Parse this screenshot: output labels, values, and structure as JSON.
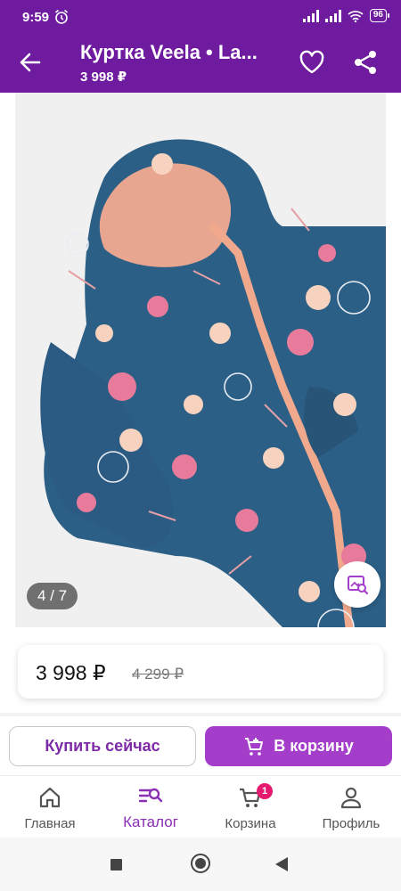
{
  "status_bar": {
    "time": "9:59",
    "battery": "96",
    "icons": [
      "alarm-icon",
      "signal-icon",
      "signal-icon",
      "wifi-icon",
      "battery-icon"
    ]
  },
  "app_bar": {
    "title": "Куртка Veela • La...",
    "subtitle": "3 998 ₽",
    "background": "#6f1ba0",
    "icons": [
      "back-arrow-icon",
      "heart-icon",
      "share-icon"
    ]
  },
  "gallery": {
    "counter": "4 / 7",
    "current_index": 4,
    "total": 7,
    "icons": [
      "visual-search-icon"
    ]
  },
  "price": {
    "current": "3 998 ₽",
    "old": "4 299 ₽"
  },
  "actions": {
    "buy_now": "Купить сейчас",
    "add_to_cart": "В корзину",
    "accent": "#a43dc9",
    "icons": [
      "add-to-cart-icon"
    ]
  },
  "bottom_nav": {
    "items": [
      {
        "label": "Главная",
        "icon": "home-icon"
      },
      {
        "label": "Каталог",
        "icon": "catalog-search-icon",
        "active": true
      },
      {
        "label": "Корзина",
        "icon": "cart-icon",
        "badge": "1"
      },
      {
        "label": "Профиль",
        "icon": "profile-icon"
      }
    ],
    "active_color": "#8b2fb5",
    "badge_color": "#e5196e"
  }
}
